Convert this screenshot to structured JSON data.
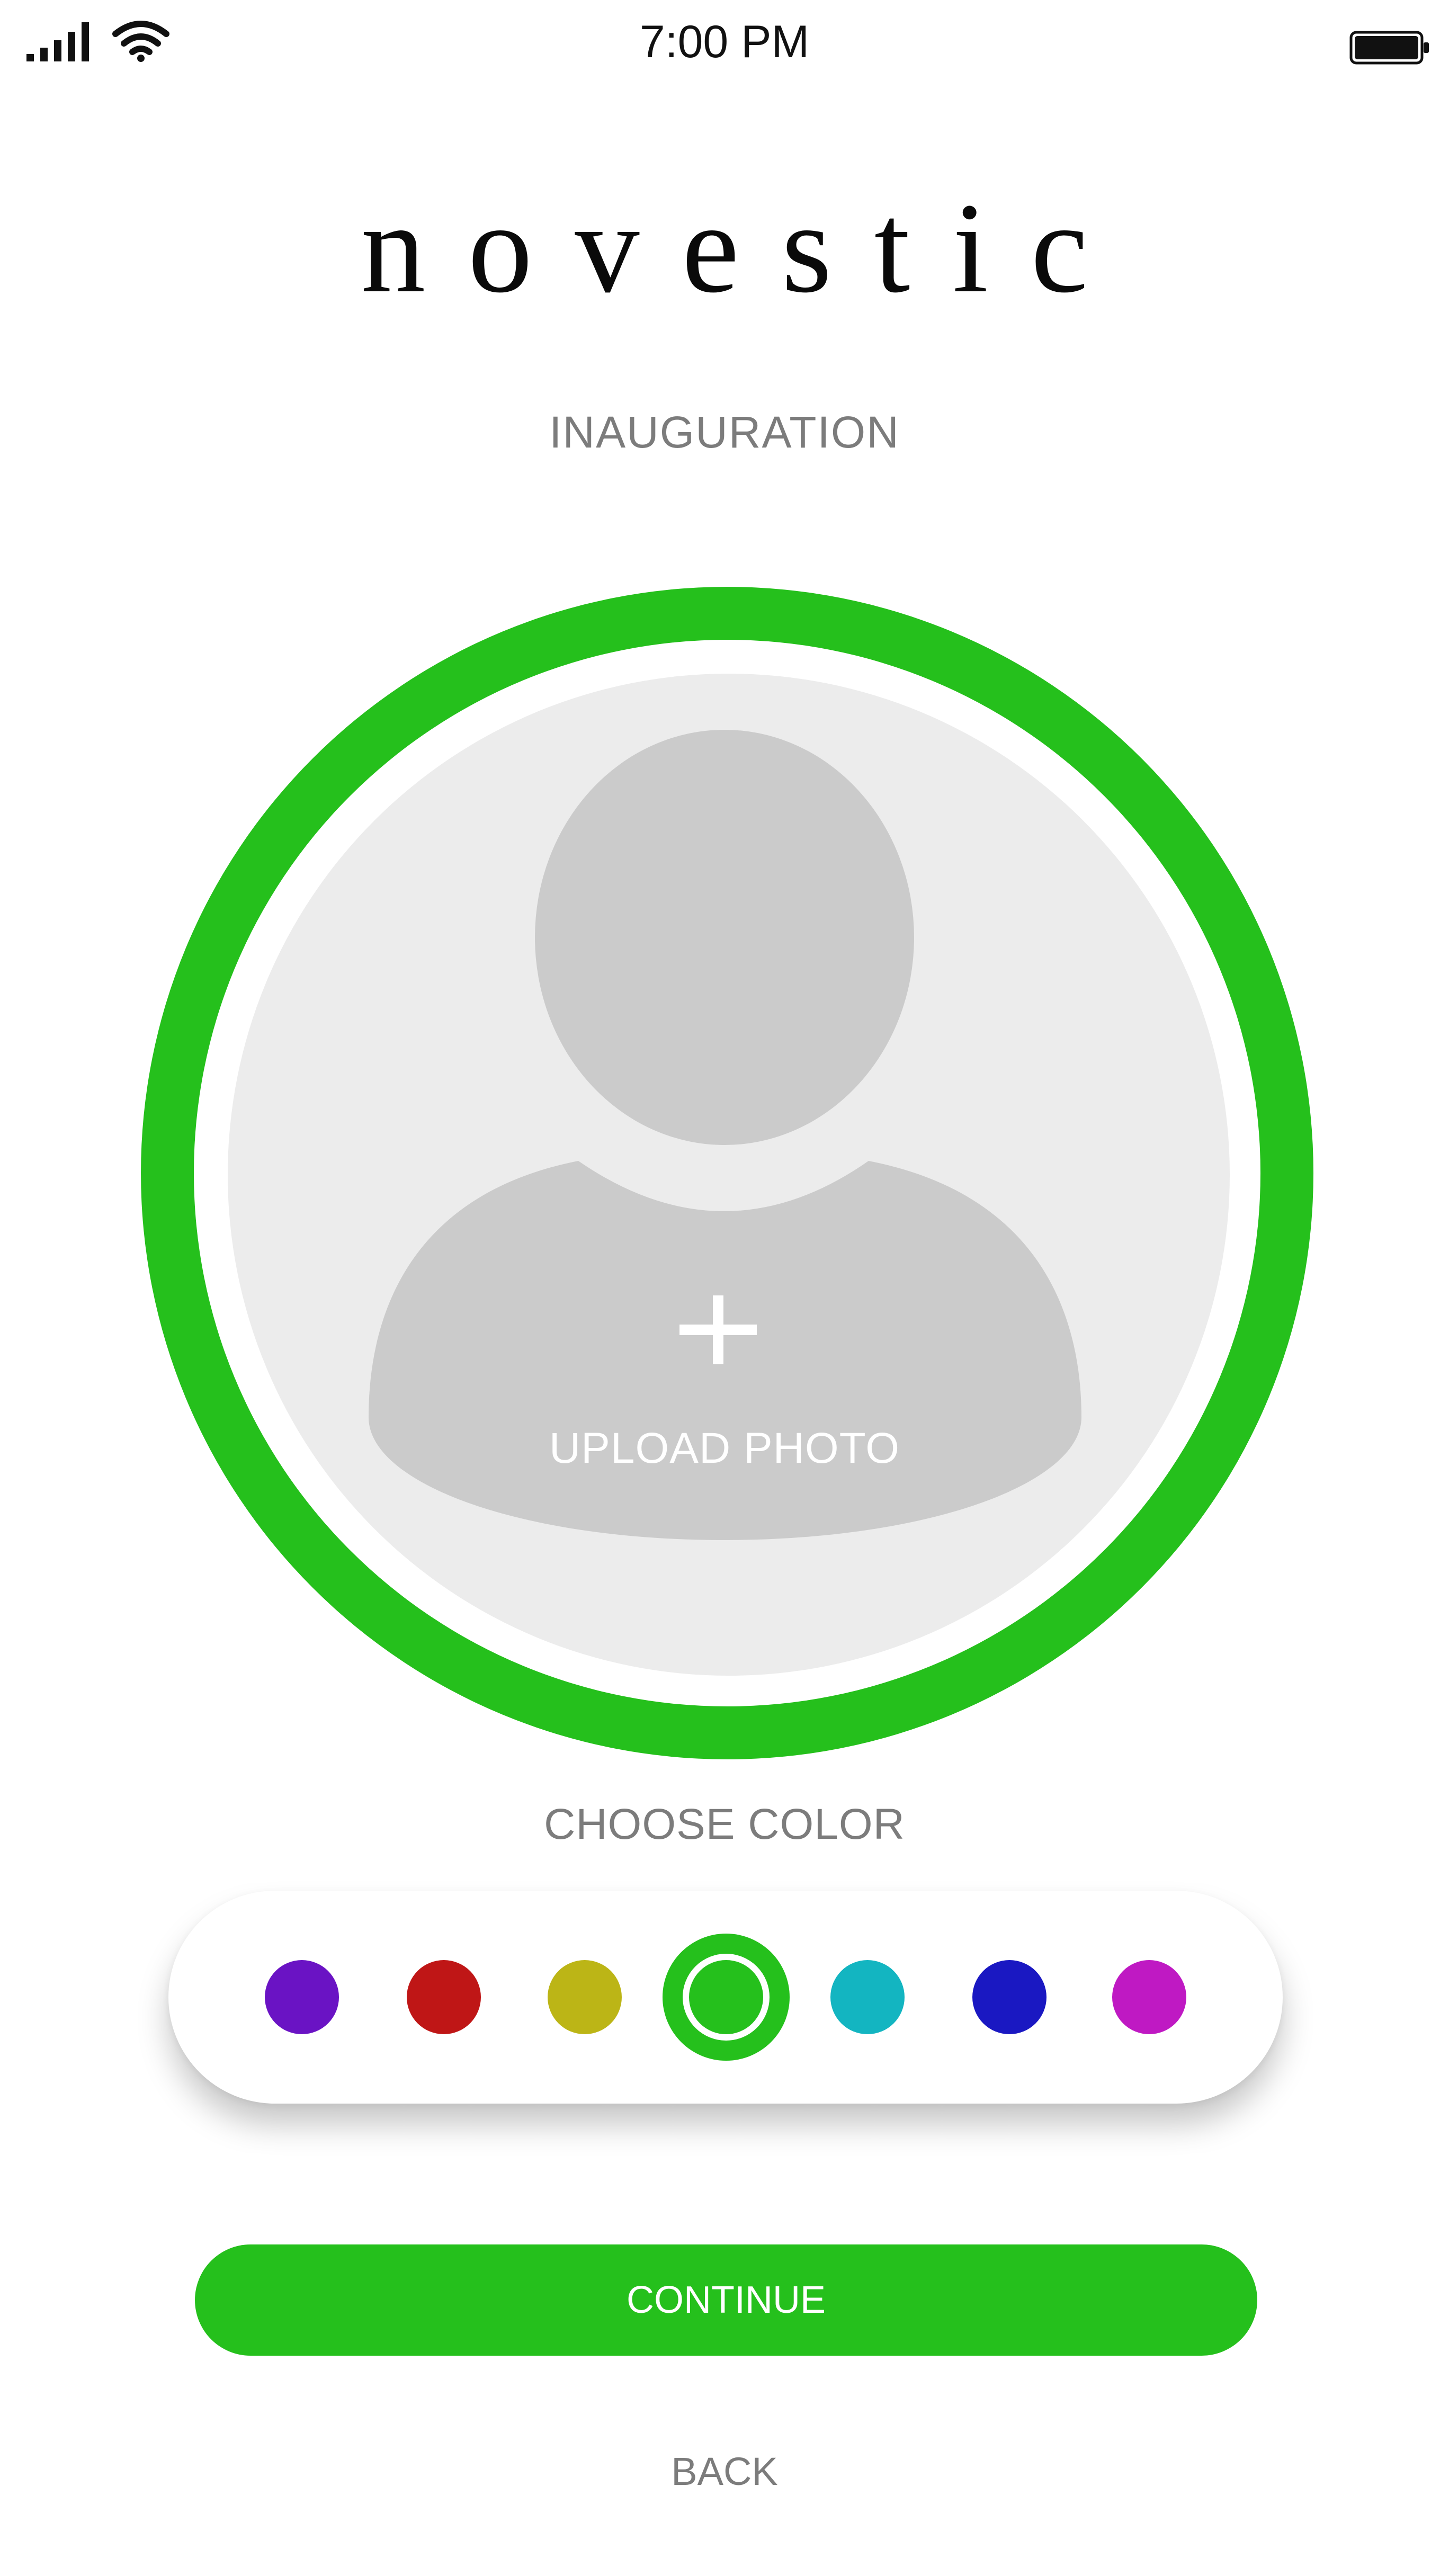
{
  "status_bar": {
    "time": "7:00 PM",
    "signal_icon": "cellular-signal-icon",
    "wifi_icon": "wifi-icon",
    "battery_icon": "battery-icon"
  },
  "brand": {
    "name": "novestic"
  },
  "page": {
    "subtitle": "INAUGURATION"
  },
  "avatar": {
    "upload_label": "UPLOAD PHOTO",
    "icon": "user-silhouette-icon",
    "plus_icon": "plus-icon",
    "ring_color": "#25c01c"
  },
  "color_picker": {
    "label": "CHOOSE COLOR",
    "selected_index": 3,
    "colors": [
      "#6a13c4",
      "#bf1616",
      "#bcb516",
      "#25c01c",
      "#13b5c1",
      "#1a18c2",
      "#bf19c3"
    ]
  },
  "actions": {
    "continue_label": "CONTINUE",
    "back_label": "BACK"
  },
  "theme": {
    "accent": "#25c01c",
    "muted_text": "#7c7c7c",
    "placeholder_bg": "#ececec",
    "silhouette": "#cbcbcb"
  }
}
